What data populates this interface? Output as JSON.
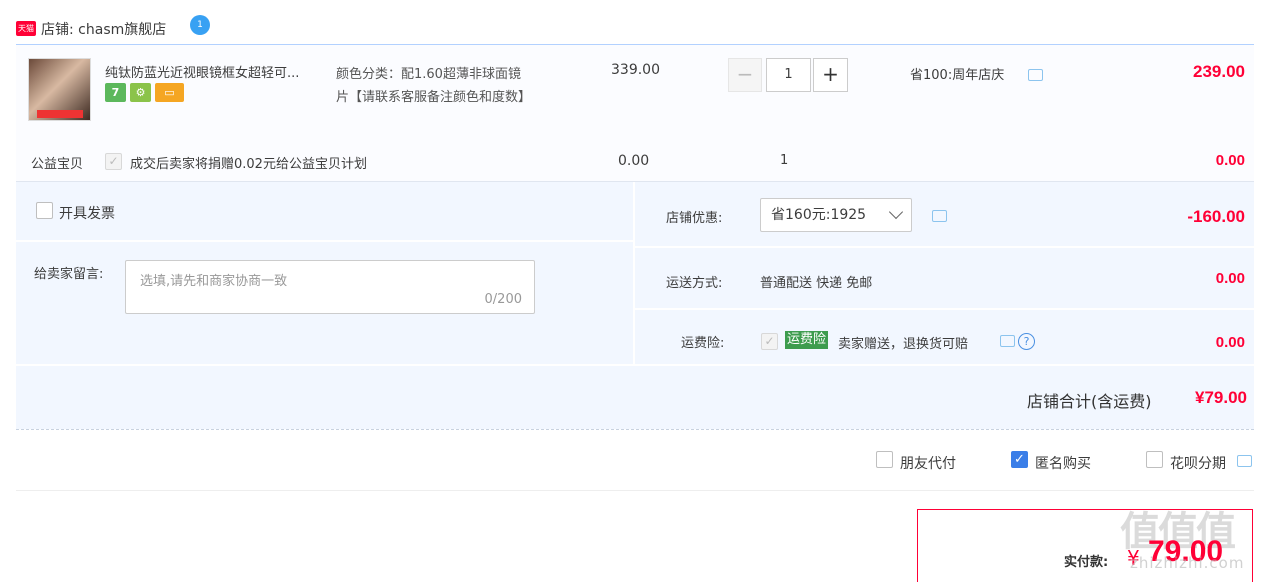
{
  "shop": {
    "logo_text": "天猫",
    "label": "店铺: chasm旗舰店",
    "ww_badge": "1"
  },
  "item": {
    "title": "纯钛防蓝光近视眼镜框女超轻可...",
    "sku_line1": "颜色分类：配1.60超薄非球面镜",
    "sku_line2": "片【请联系客服备注颜色和度数】",
    "unit_price": "339.00",
    "quantity": "1",
    "qty_minus": "−",
    "qty_plus": "+",
    "promo": "省100:周年店庆",
    "amount": "239.00",
    "badges": [
      "7",
      "⚙",
      "▭"
    ]
  },
  "charity": {
    "label": "公益宝贝",
    "checkmark": "✓",
    "text": "成交后卖家将捐赠0.02元给公益宝贝计划",
    "price": "0.00",
    "quantity": "1",
    "amount": "0.00"
  },
  "invoice": {
    "label": "开具发票"
  },
  "message": {
    "label": "给卖家留言:",
    "placeholder": "选填,请先和商家协商一致",
    "counter": "0/200"
  },
  "discount": {
    "label": "店铺优惠:",
    "selected": "省160元:1925",
    "amount": "-160.00"
  },
  "shipping": {
    "label": "运送方式:",
    "value": "普通配送 快递 免邮",
    "amount": "0.00"
  },
  "insurance": {
    "label": "运费险:",
    "checkmark": "✓",
    "tag": "运费险",
    "text": "卖家赠送，退换货可赔",
    "help": "?",
    "amount": "0.00"
  },
  "shop_total": {
    "label": "店铺合计(含运费)",
    "value": "¥79.00"
  },
  "options": [
    {
      "label": "朋友代付",
      "checked": false
    },
    {
      "label": "匿名购买",
      "checked": true
    },
    {
      "label": "花呗分期",
      "checked": false
    }
  ],
  "option_checkmark": "✓",
  "payment": {
    "label": "实付款:",
    "currency": "¥",
    "value": "79.00"
  },
  "watermark": {
    "text": "值值值",
    "sub": "zhizhizhi.com"
  },
  "colors": {
    "accent_red": "#ff0036",
    "light_bg": "#f2f7ff",
    "check_blue": "#3a7ee8",
    "insurance_green": "#3d9c4e"
  }
}
